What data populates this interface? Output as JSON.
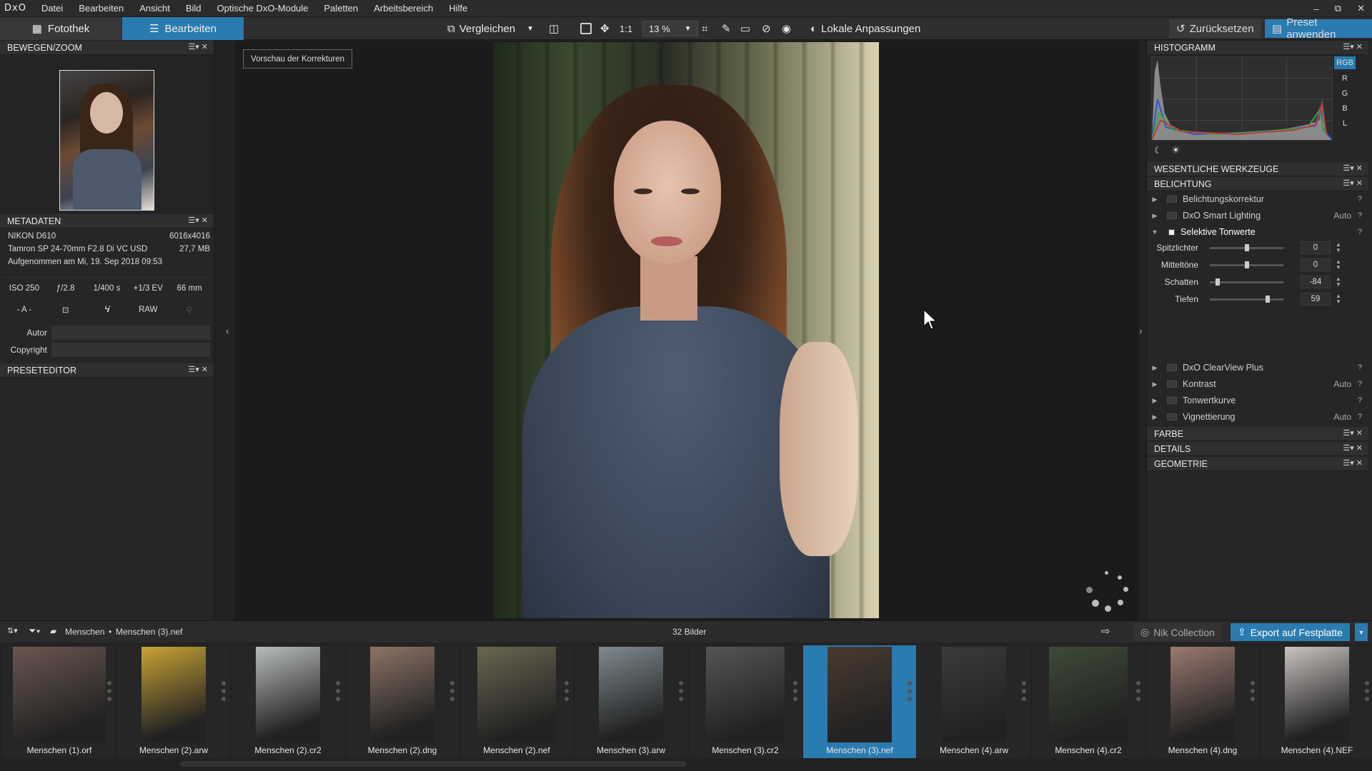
{
  "menubar": {
    "logo": "DxO",
    "items": [
      "Datei",
      "Bearbeiten",
      "Ansicht",
      "Bild",
      "Optische DxO-Module",
      "Paletten",
      "Arbeitsbereich",
      "Hilfe"
    ],
    "window_controls": [
      "–",
      "⧉",
      "✕"
    ]
  },
  "toolbar": {
    "tab_library": "Fotothek",
    "tab_edit": "Bearbeiten",
    "compare": "Vergleichen",
    "one_to_one": "1:1",
    "zoom": "13 %",
    "local_adjustments": "Lokale Anpassungen",
    "reset": "Zurücksetzen",
    "apply_preset": "Preset anwenden",
    "accent": "#2a7bb0"
  },
  "left": {
    "move_zoom": "BEWEGEN/ZOOM",
    "metadata_title": "METADATEN",
    "camera": "NIKON D610",
    "resolution": "6016x4016",
    "lens": "Tamron SP 24-70mm F2.8 Di VC USD",
    "filesize": "27,7 MB",
    "taken": "Aufgenommen am Mi, 19. Sep 2018 09:53",
    "iso": "ISO 250",
    "aperture": "ƒ/2.8",
    "shutter": "1/400 s",
    "ev": "+1/3 EV",
    "focal": "66 mm",
    "mode": "- A -",
    "format": "RAW",
    "author_label": "Autor",
    "copyright_label": "Copyright",
    "preset_editor": "PRESETEDITOR"
  },
  "viewer": {
    "preview_label": "Vorschau der Korrekturen"
  },
  "right": {
    "histogram": "HISTOGRAMM",
    "channels": [
      "RGB",
      "R",
      "G",
      "B",
      "L"
    ],
    "essential_tools": "WESENTLICHE WERKZEUGE",
    "exposure": "BELICHTUNG",
    "tools": [
      {
        "label": "Belichtungskorrektur",
        "auto": ""
      },
      {
        "label": "DxO Smart Lighting",
        "auto": "Auto"
      },
      {
        "label": "Selektive Tonwerte",
        "auto": ""
      }
    ],
    "sliders": [
      {
        "label": "Spitzlichter",
        "value": "0",
        "pos": 0.5
      },
      {
        "label": "Mitteltöne",
        "value": "0",
        "pos": 0.5
      },
      {
        "label": "Schatten",
        "value": "-84",
        "pos": 0.08
      },
      {
        "label": "Tiefen",
        "value": "59",
        "pos": 0.8
      }
    ],
    "tools2": [
      {
        "label": "DxO ClearView Plus",
        "auto": ""
      },
      {
        "label": "Kontrast",
        "auto": "Auto"
      },
      {
        "label": "Tonwertkurve",
        "auto": ""
      },
      {
        "label": "Vignettierung",
        "auto": "Auto"
      }
    ],
    "sections": [
      "FARBE",
      "DETAILS",
      "GEOMETRIE"
    ]
  },
  "filmbar": {
    "folder": "Menschen",
    "file": "Menschen (3).nef",
    "count": "32 Bilder",
    "nik": "Nik Collection",
    "export": "Export auf Festplatte"
  },
  "filmstrip": [
    {
      "name": "Menschen (1).orf",
      "color": "#6a5650"
    },
    {
      "name": "Menschen (2).arw",
      "color": "#c9a335"
    },
    {
      "name": "Menschen (2).cr2",
      "color": "#b9bcbd"
    },
    {
      "name": "Menschen (2).dng",
      "color": "#8c7466"
    },
    {
      "name": "Menschen (2).nef",
      "color": "#6a6650"
    },
    {
      "name": "Menschen (3).arw",
      "color": "#7f8a90"
    },
    {
      "name": "Menschen (3).cr2",
      "color": "#555"
    },
    {
      "name": "Menschen (3).nef",
      "color": "#4a3a30"
    },
    {
      "name": "Menschen (4).arw",
      "color": "#3a3a3a"
    },
    {
      "name": "Menschen (4).cr2",
      "color": "#3e4a36"
    },
    {
      "name": "Menschen (4).dng",
      "color": "#9a7a70"
    },
    {
      "name": "Menschen (4).NEF",
      "color": "#c9c3c1"
    }
  ]
}
